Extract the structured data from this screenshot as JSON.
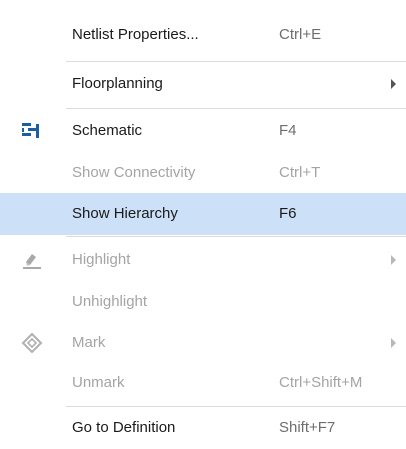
{
  "menu": {
    "items": [
      {
        "label": "Netlist Properties...",
        "shortcut": "Ctrl+E"
      },
      {
        "label": "Floorplanning",
        "shortcut": ""
      },
      {
        "label": "Schematic",
        "shortcut": "F4"
      },
      {
        "label": "Show Connectivity",
        "shortcut": "Ctrl+T"
      },
      {
        "label": "Show Hierarchy",
        "shortcut": "F6"
      },
      {
        "label": "Highlight",
        "shortcut": ""
      },
      {
        "label": "Unhighlight",
        "shortcut": ""
      },
      {
        "label": "Mark",
        "shortcut": ""
      },
      {
        "label": "Unmark",
        "shortcut": "Ctrl+Shift+M"
      },
      {
        "label": "Go to Definition",
        "shortcut": "Shift+F7"
      }
    ],
    "icons": {
      "schematic": "schematic-icon",
      "highlight": "highlight-icon",
      "mark": "mark-icon"
    },
    "colors": {
      "selected_background": "#cce0f8",
      "icon_blue": "#1b5f9e",
      "disabled_text": "#a4a4a4"
    }
  }
}
